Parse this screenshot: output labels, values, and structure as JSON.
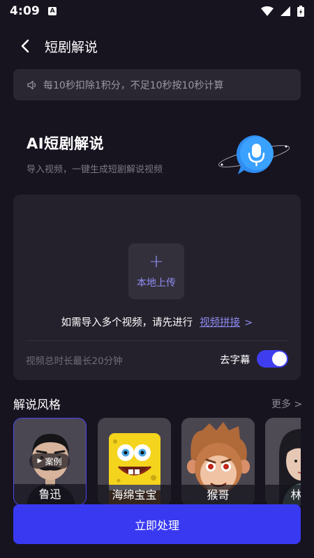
{
  "status_bar": {
    "time": "4:09",
    "app_badge": "A"
  },
  "header": {
    "title": "短剧解说"
  },
  "notice": {
    "text": "每10秒扣除1积分，不足10秒按10秒计算"
  },
  "hero": {
    "title": "AI短剧解说",
    "subtitle": "导入视频，一键生成短剧解说视频"
  },
  "upload": {
    "plus": "+",
    "button_label": "本地上传",
    "hint_prefix": "如需导入多个视频，请先进行",
    "hint_link": "视频拼接",
    "hint_arrow": ">",
    "duration_limit": "视频总时长最长20分钟",
    "subtitle_toggle_label": "去字幕",
    "subtitle_toggle_on": true
  },
  "styles": {
    "section_title": "解说风格",
    "more": "更多 >",
    "case_badge": "案例",
    "items": [
      {
        "name": "鲁迅"
      },
      {
        "name": "海绵宝宝"
      },
      {
        "name": "猴哥"
      },
      {
        "name": "林黛"
      }
    ]
  },
  "primary_button": {
    "label": "立即处理"
  },
  "colors": {
    "background": "#17131f",
    "accent": "#3939f2",
    "link": "#8f8cf2",
    "card": "#24212c"
  }
}
